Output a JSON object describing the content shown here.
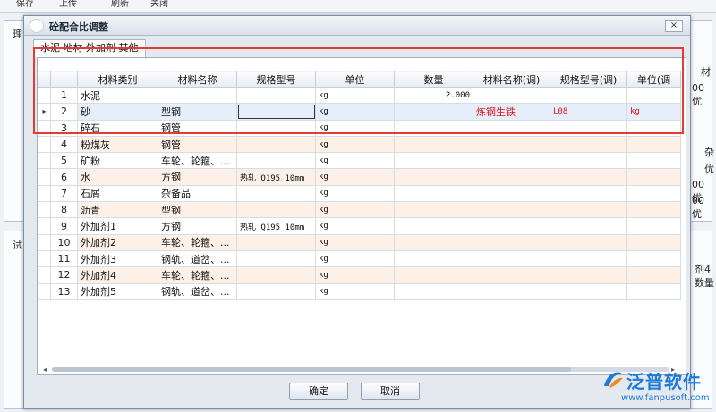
{
  "background": {
    "toolbar_items": [
      "保存",
      "上传",
      "刷新",
      "关闭"
    ],
    "left_labels": [
      "理",
      "试"
    ],
    "right_texts": [
      "材",
      "00 优",
      "杂",
      "优",
      "00 优",
      "00 优",
      "剂4",
      "数量"
    ]
  },
  "dialog": {
    "title": "砼配合比调整",
    "close_glyph": "×",
    "tab_label": "水泥  地材  外加剂  其他",
    "columns": [
      "材料类别",
      "材料名称",
      "规格型号",
      "单位",
      "数量",
      "材料名称(调)",
      "规格型号(调)",
      "单位(调"
    ],
    "rows": [
      {
        "idx": "1",
        "cat": "水泥",
        "name": "",
        "spec": "",
        "unit": "kg",
        "qty": "2.000",
        "name2": "",
        "spec2": "",
        "unit2": ""
      },
      {
        "idx": "2",
        "cat": "砂",
        "name": "型钢",
        "spec": "",
        "unit": "kg",
        "qty": "",
        "name2": "炼钢生铁",
        "spec2": "L08",
        "unit2": "kg",
        "selected": true
      },
      {
        "idx": "3",
        "cat": "碎石",
        "name": "钢管",
        "spec": "",
        "unit": "kg",
        "qty": "",
        "name2": "",
        "spec2": "",
        "unit2": ""
      },
      {
        "idx": "4",
        "cat": "粉煤灰",
        "name": "钢管",
        "spec": "",
        "unit": "kg",
        "qty": "",
        "name2": "",
        "spec2": "",
        "unit2": ""
      },
      {
        "idx": "5",
        "cat": "矿粉",
        "name": "车轮、轮箍、...",
        "spec": "",
        "unit": "kg",
        "qty": "",
        "name2": "",
        "spec2": "",
        "unit2": ""
      },
      {
        "idx": "6",
        "cat": "水",
        "name": "方钢",
        "spec": "热轧 Q195 10mm",
        "unit": "kg",
        "qty": "",
        "name2": "",
        "spec2": "",
        "unit2": ""
      },
      {
        "idx": "7",
        "cat": "石屑",
        "name": "杂备品",
        "spec": "",
        "unit": "kg",
        "qty": "",
        "name2": "",
        "spec2": "",
        "unit2": ""
      },
      {
        "idx": "8",
        "cat": "沥青",
        "name": "型钢",
        "spec": "",
        "unit": "kg",
        "qty": "",
        "name2": "",
        "spec2": "",
        "unit2": ""
      },
      {
        "idx": "9",
        "cat": "外加剂1",
        "name": "方钢",
        "spec": "热轧 Q195 10mm",
        "unit": "kg",
        "qty": "",
        "name2": "",
        "spec2": "",
        "unit2": ""
      },
      {
        "idx": "10",
        "cat": "外加剂2",
        "name": "车轮、轮箍、...",
        "spec": "",
        "unit": "kg",
        "qty": "",
        "name2": "",
        "spec2": "",
        "unit2": ""
      },
      {
        "idx": "11",
        "cat": "外加剂3",
        "name": "钢轨、道岔、...",
        "spec": "",
        "unit": "kg",
        "qty": "",
        "name2": "",
        "spec2": "",
        "unit2": ""
      },
      {
        "idx": "12",
        "cat": "外加剂4",
        "name": "车轮、轮箍、...",
        "spec": "",
        "unit": "kg",
        "qty": "",
        "name2": "",
        "spec2": "",
        "unit2": ""
      },
      {
        "idx": "13",
        "cat": "外加剂5",
        "name": "钢轨、道岔、...",
        "spec": "",
        "unit": "kg",
        "qty": "",
        "name2": "",
        "spec2": "",
        "unit2": ""
      }
    ],
    "ok_label": "确定",
    "cancel_label": "取消",
    "selected_row_indicator": "▸"
  },
  "watermark": {
    "brand": "泛普软件",
    "url": "www.fanpusoft.com"
  },
  "colors": {
    "highlight_border": "#e53b35",
    "adjusted_text": "#e0101c",
    "brand_blue": "#1d7bd6"
  }
}
